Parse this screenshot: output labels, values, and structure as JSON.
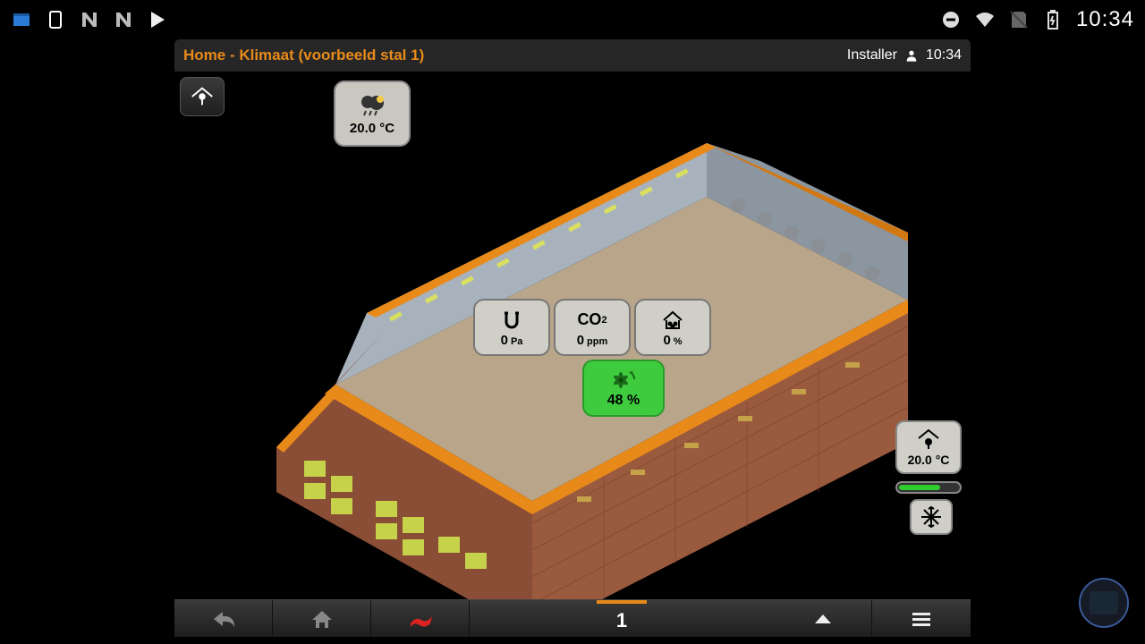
{
  "status": {
    "time": "10:34",
    "icons_left": [
      "file-manager",
      "screen-rotate",
      "n-icon",
      "n-icon-2",
      "play-store"
    ],
    "icons_right": [
      "dnd",
      "wifi",
      "no-sim",
      "battery-charging"
    ]
  },
  "header": {
    "title": "Home - Klimaat (voorbeeld stal 1)",
    "user_role": "Installer",
    "time": "10:34"
  },
  "weather": {
    "temp": "20.0 °C",
    "condition": "rain-cloud"
  },
  "sensors": {
    "pressure": {
      "value": "0",
      "unit": "Pa"
    },
    "co2": {
      "label_main": "CO",
      "label_sub": "2",
      "value": "0",
      "unit": "ppm"
    },
    "humidity": {
      "value": "0",
      "unit": "%"
    },
    "fan": {
      "value": "48",
      "unit": "%"
    }
  },
  "right_temp": {
    "value": "20.0 °C",
    "progress_pct": 70
  },
  "bottom": {
    "page": "1"
  }
}
